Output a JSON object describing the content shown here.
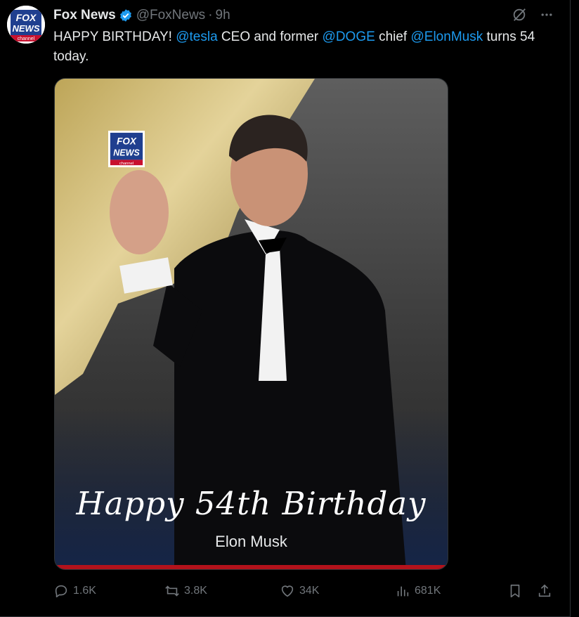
{
  "tweet": {
    "author_name": "Fox News",
    "author_handle": "@FoxNews",
    "separator": "·",
    "timestamp": "9h",
    "text_parts": {
      "p1": "HAPPY BIRTHDAY! ",
      "m1": "@tesla",
      "p2": " CEO and former ",
      "m2": "@DOGE",
      "p3": " chief ",
      "m3": "@ElonMusk",
      "p4": " turns 54 today."
    },
    "avatar_logo": {
      "line1": "FOX",
      "line2": "NEWS",
      "line3": "channel"
    }
  },
  "media": {
    "headline": "Happy 54th Birthday",
    "subtitle": "Elon Musk",
    "logo": {
      "line1": "FOX",
      "line2": "NEWS",
      "line3": "channel"
    }
  },
  "actions": {
    "replies": "1.6K",
    "reposts": "3.8K",
    "likes": "34K",
    "views": "681K"
  },
  "colors": {
    "accent": "#1d9bf0",
    "background": "#000000",
    "muted": "#71767b",
    "brand_red": "#b3121b",
    "brand_blue": "#1f3f8f"
  },
  "icons": [
    "grok-icon",
    "more-icon",
    "reply-icon",
    "repost-icon",
    "like-icon",
    "views-icon",
    "bookmark-icon",
    "share-icon",
    "verified-icon"
  ]
}
